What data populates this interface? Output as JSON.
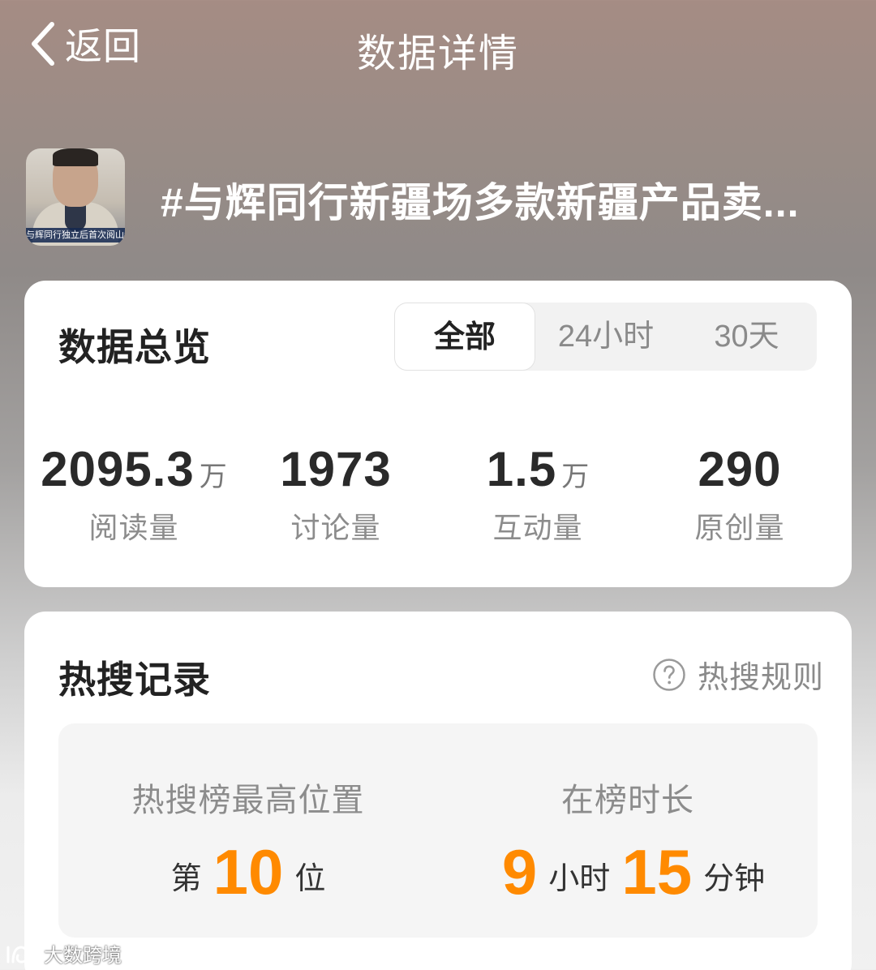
{
  "header": {
    "back_label": "返回",
    "title": "数据详情"
  },
  "topic": {
    "title": "#与辉同行新疆场多款新疆产品卖...",
    "thumbnail_caption": "与辉同行独立后首次阅山河专"
  },
  "overview": {
    "title": "数据总览",
    "tabs": [
      {
        "label": "全部",
        "selected": true
      },
      {
        "label": "24小时",
        "selected": false
      },
      {
        "label": "30天",
        "selected": false
      }
    ],
    "stats": [
      {
        "value": "2095.3",
        "unit": "万",
        "label": "阅读量"
      },
      {
        "value": "1973",
        "unit": "",
        "label": "讨论量"
      },
      {
        "value": "1.5",
        "unit": "万",
        "label": "互动量"
      },
      {
        "value": "290",
        "unit": "",
        "label": "原创量"
      }
    ]
  },
  "hot_search": {
    "title": "热搜记录",
    "rules_label": "热搜规则",
    "rules_icon": "help-circle-icon",
    "peak": {
      "label": "热搜榜最高位置",
      "prefix": "第",
      "value": "10",
      "suffix": "位"
    },
    "duration": {
      "label": "在榜时长",
      "hours": "9",
      "hours_unit": "小时",
      "minutes": "15",
      "minutes_unit": "分钟"
    }
  },
  "watermark": {
    "text": "大数跨境"
  },
  "colors": {
    "accent_orange": "#ff8a00",
    "card_bg": "#ffffff",
    "text_primary": "#222222",
    "text_secondary": "#8c8c8c"
  }
}
